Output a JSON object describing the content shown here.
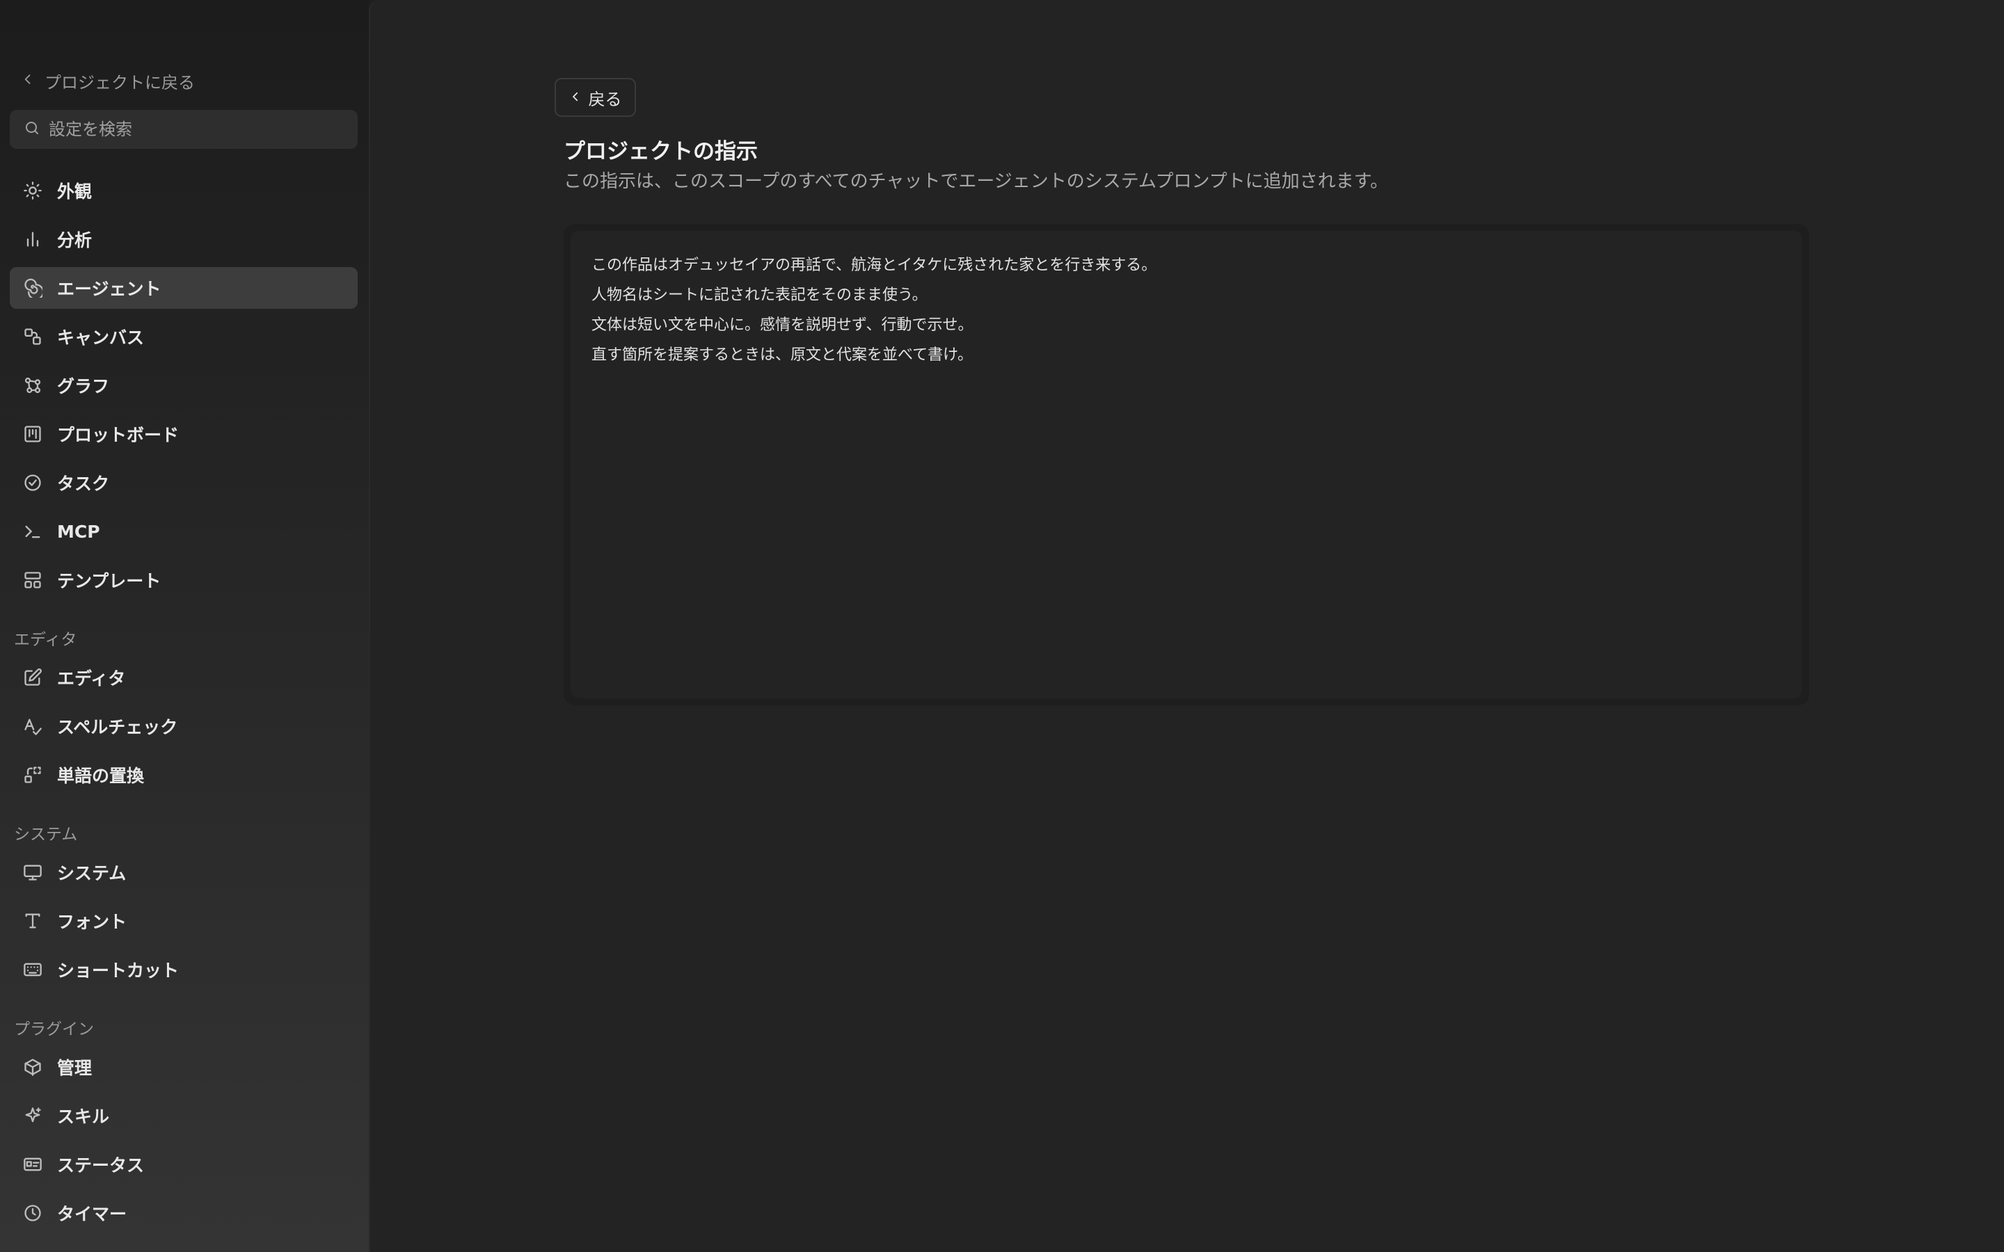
{
  "sidebar": {
    "back_label": "プロジェクトに戻る",
    "search_placeholder": "設定を検索",
    "items": [
      {
        "label": "外観",
        "icon": "sun-icon"
      },
      {
        "label": "分析",
        "icon": "bar-chart-icon"
      },
      {
        "label": "エージェント",
        "icon": "spiral-icon",
        "active": true
      },
      {
        "label": "キャンバス",
        "icon": "canvas-icon"
      },
      {
        "label": "グラフ",
        "icon": "graph-icon"
      },
      {
        "label": "プロットボード",
        "icon": "plotboard-icon"
      },
      {
        "label": "タスク",
        "icon": "check-circle-icon"
      },
      {
        "label": "MCP",
        "icon": "terminal-icon"
      },
      {
        "label": "テンプレート",
        "icon": "template-icon"
      }
    ],
    "sections": [
      {
        "label": "エディタ",
        "items": [
          {
            "label": "エディタ",
            "icon": "edit-icon"
          },
          {
            "label": "スペルチェック",
            "icon": "spellcheck-icon"
          },
          {
            "label": "単語の置換",
            "icon": "replace-icon"
          }
        ]
      },
      {
        "label": "システム",
        "items": [
          {
            "label": "システム",
            "icon": "monitor-icon"
          },
          {
            "label": "フォント",
            "icon": "font-icon"
          },
          {
            "label": "ショートカット",
            "icon": "keyboard-icon"
          }
        ]
      },
      {
        "label": "プラグイン",
        "items": [
          {
            "label": "管理",
            "icon": "box-icon"
          },
          {
            "label": "スキル",
            "icon": "sparkle-icon"
          },
          {
            "label": "ステータス",
            "icon": "id-card-icon"
          },
          {
            "label": "タイマー",
            "icon": "clock-icon"
          }
        ]
      }
    ]
  },
  "main": {
    "back_button": "戻る",
    "title": "プロジェクトの指示",
    "description": "この指示は、このスコープのすべてのチャットでエージェントのシステムプロンプトに追加されます。",
    "instructions": [
      "この作品はオデュッセイアの再話で、航海とイタケに残された家とを行き来する。",
      "人物名はシートに記された表記をそのまま使う。",
      "文体は短い文を中心に。感情を説明せず、行動で示せ。",
      "直す箇所を提案するときは、原文と代案を並べて書け。"
    ]
  }
}
